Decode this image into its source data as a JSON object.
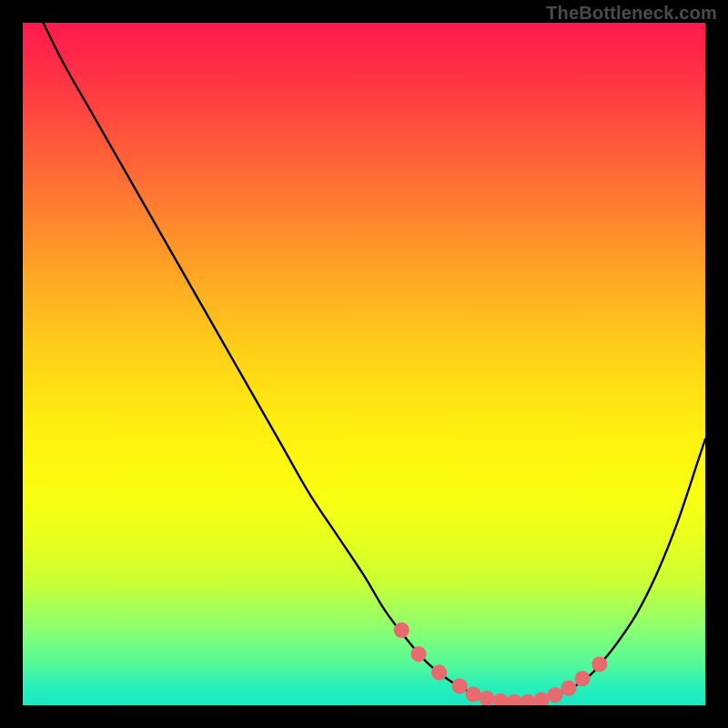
{
  "attribution": "TheBottleneck.com",
  "colors": {
    "marker": "#e86a6f",
    "curve_stroke": "#000000",
    "frame_bg": "#000000"
  },
  "chart_data": {
    "type": "line",
    "title": "",
    "xlabel": "",
    "ylabel": "",
    "xlim": [
      0,
      100
    ],
    "ylim": [
      0,
      100
    ],
    "grid": false,
    "legend": false,
    "series": [
      {
        "name": "bottleneck-curve",
        "x": [
          3,
          6,
          10,
          14,
          18,
          22,
          26,
          30,
          34,
          38,
          42,
          46,
          50,
          53,
          56,
          59,
          62,
          65,
          68,
          71,
          74,
          77,
          80,
          83,
          85,
          87,
          90,
          93,
          96,
          99,
          100
        ],
        "values": [
          100,
          94,
          87,
          80,
          73,
          66,
          59,
          52,
          45,
          38,
          31,
          25,
          19,
          14,
          10,
          6.5,
          4,
          2.2,
          1.1,
          0.5,
          0.5,
          1.1,
          2.3,
          4.3,
          6.5,
          9,
          13.5,
          19.5,
          27,
          36,
          39
        ]
      }
    ],
    "markers": {
      "name": "highlighted-points",
      "x": [
        55.5,
        58,
        61,
        64,
        66,
        68,
        70,
        72,
        74,
        76,
        78,
        80,
        82,
        84.5
      ],
      "values": [
        11,
        7.5,
        4.8,
        2.8,
        1.6,
        1.0,
        0.6,
        0.5,
        0.5,
        0.8,
        1.5,
        2.5,
        3.9,
        6.0
      ]
    }
  }
}
